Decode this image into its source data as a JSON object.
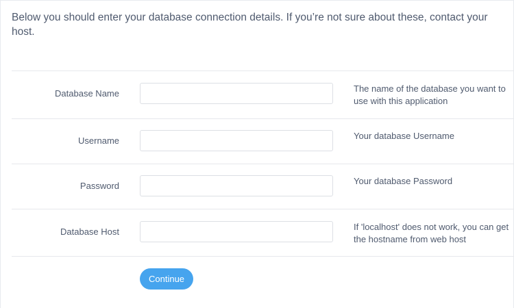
{
  "intro": {
    "text": "Below you should enter your database connection details. If you’re not sure about these, contact your host."
  },
  "fields": [
    {
      "label": "Database Name",
      "value": "",
      "placeholder": "",
      "help": "The name of the database you want to use with this application"
    },
    {
      "label": "Username",
      "value": "",
      "placeholder": "",
      "help": "Your database Username"
    },
    {
      "label": "Password",
      "value": "",
      "placeholder": "",
      "help": "Your database Password"
    },
    {
      "label": "Database Host",
      "value": "",
      "placeholder": "",
      "help": "If 'localhost' does not work, you can get the hostname from web host"
    }
  ],
  "actions": {
    "continue_label": "Continue"
  },
  "colors": {
    "accent": "#46a4ee",
    "text": "#4f5a6e",
    "border": "#dcdfe4"
  }
}
